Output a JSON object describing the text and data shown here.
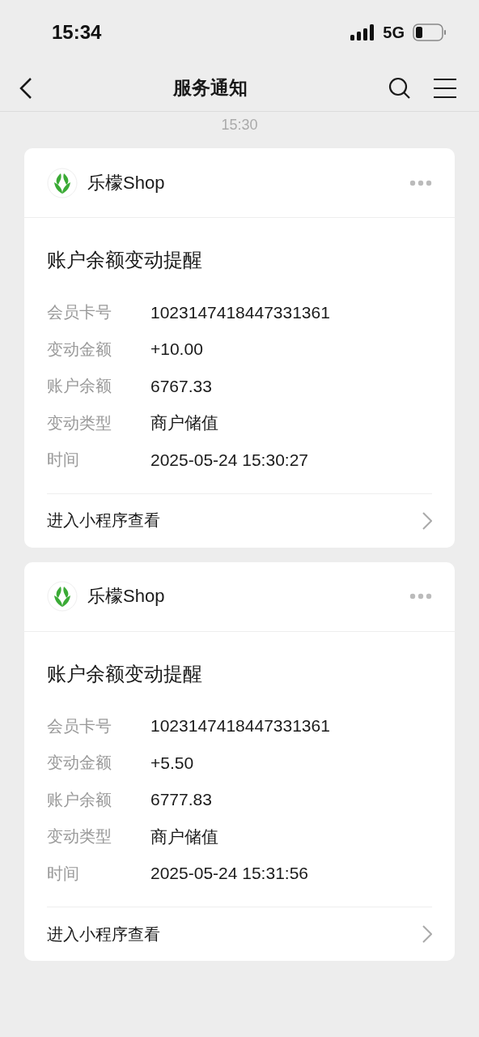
{
  "status_bar": {
    "time": "15:34",
    "network": "5G"
  },
  "nav": {
    "title": "服务通知"
  },
  "timestamp": "15:30",
  "messages": [
    {
      "sender": "乐檬Shop",
      "title": "账户余额变动提醒",
      "fields": [
        {
          "label": "会员卡号",
          "value": "1023147418447331361"
        },
        {
          "label": "变动金额",
          "value": "+10.00"
        },
        {
          "label": "账户余额",
          "value": "6767.33"
        },
        {
          "label": "变动类型",
          "value": "商户储值"
        },
        {
          "label": "时间",
          "value": "2025-05-24 15:30:27"
        }
      ],
      "action": "进入小程序查看"
    },
    {
      "sender": "乐檬Shop",
      "title": "账户余额变动提醒",
      "fields": [
        {
          "label": "会员卡号",
          "value": "1023147418447331361"
        },
        {
          "label": "变动金额",
          "value": "+5.50"
        },
        {
          "label": "账户余额",
          "value": "6777.83"
        },
        {
          "label": "变动类型",
          "value": "商户储值"
        },
        {
          "label": "时间",
          "value": "2025-05-24 15:31:56"
        }
      ],
      "action": "进入小程序查看"
    }
  ]
}
